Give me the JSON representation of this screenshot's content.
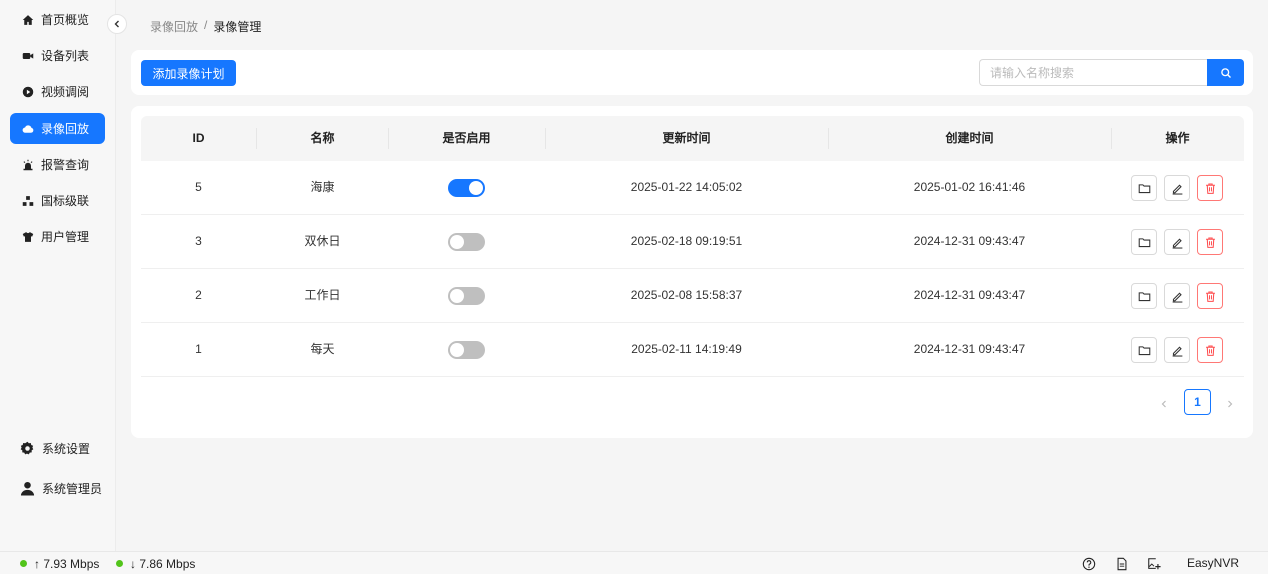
{
  "sidebar": {
    "items": [
      {
        "label": "首页概览",
        "icon": "home-icon",
        "active": false
      },
      {
        "label": "设备列表",
        "icon": "camera-icon",
        "active": false
      },
      {
        "label": "视频调阅",
        "icon": "play-circle-icon",
        "active": false
      },
      {
        "label": "录像回放",
        "icon": "cloud-icon",
        "active": true
      },
      {
        "label": "报警查询",
        "icon": "alarm-icon",
        "active": false
      },
      {
        "label": "国标级联",
        "icon": "cascade-icon",
        "active": false
      },
      {
        "label": "用户管理",
        "icon": "shirt-icon",
        "active": false
      }
    ],
    "bottom": [
      {
        "label": "系统设置",
        "icon": "gear-icon"
      },
      {
        "label": "系统管理员",
        "icon": "user-icon"
      }
    ]
  },
  "breadcrumb": {
    "parent": "录像回放",
    "separator": "/",
    "current": "录像管理"
  },
  "toolbar": {
    "add_label": "添加录像计划",
    "search_placeholder": "请输入名称搜索"
  },
  "table": {
    "columns": [
      "ID",
      "名称",
      "是否启用",
      "更新时间",
      "创建时间",
      "操作"
    ],
    "rows": [
      {
        "id": "5",
        "name": "海康",
        "enabled": true,
        "updated": "2025-01-22 14:05:02",
        "created": "2025-01-02 16:41:46"
      },
      {
        "id": "3",
        "name": "双休日",
        "enabled": false,
        "updated": "2025-02-18 09:19:51",
        "created": "2024-12-31 09:43:47"
      },
      {
        "id": "2",
        "name": "工作日",
        "enabled": false,
        "updated": "2025-02-08 15:58:37",
        "created": "2024-12-31 09:43:47"
      },
      {
        "id": "1",
        "name": "每天",
        "enabled": false,
        "updated": "2025-02-11 14:19:49",
        "created": "2024-12-31 09:43:47"
      }
    ]
  },
  "pagination": {
    "current": "1"
  },
  "statusbar": {
    "upload": "↑ 7.93 Mbps",
    "download": "↓ 7.86 Mbps",
    "brand": "EasyNVR"
  },
  "colors": {
    "accent": "#1677ff",
    "danger": "#ff4d4f",
    "online": "#52c41a"
  }
}
